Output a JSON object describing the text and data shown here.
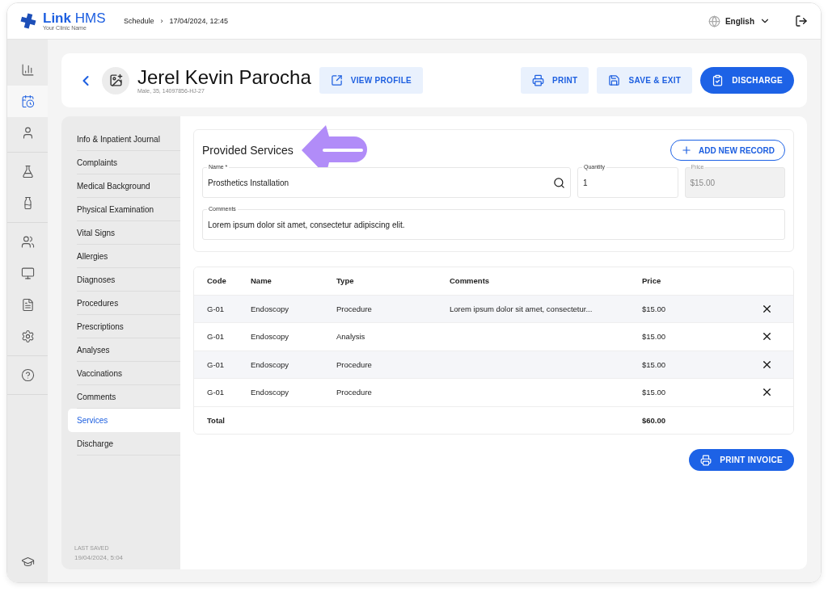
{
  "brand": {
    "name_bold": "Link",
    "name_light": "HMS",
    "subtitle": "Your Clinic Name"
  },
  "breadcrumb": {
    "items": [
      "Schedule",
      "17/04/2024, 12:45"
    ],
    "separator": "›"
  },
  "language": "English",
  "rail": [
    {
      "selected": false
    },
    {
      "selected": true
    },
    {
      "selected": false
    },
    {
      "selected": false
    },
    {
      "selected": false
    },
    {
      "selected": false
    },
    {
      "selected": false
    },
    {
      "selected": false
    },
    {
      "selected": false
    },
    {
      "selected": false
    },
    {
      "selected": false
    }
  ],
  "patient": {
    "name": "Jerel Kevin Parocha",
    "details": "Male, 35, 14097856-HJ-27"
  },
  "header_buttons": [
    {
      "label": "VIEW PROFILE",
      "kind": "soft"
    },
    {
      "label": "PRINT",
      "kind": "soft"
    },
    {
      "label": "SAVE & EXIT",
      "kind": "soft"
    },
    {
      "label": "DISCHARGE",
      "kind": "primary"
    }
  ],
  "sections": [
    {
      "label": "Info & Inpatient Journal",
      "selected": false
    },
    {
      "label": "Complaints",
      "selected": false
    },
    {
      "label": "Medical Background",
      "selected": false
    },
    {
      "label": "Physical Examination",
      "selected": false
    },
    {
      "label": "Vital Signs",
      "selected": false
    },
    {
      "label": "Allergies",
      "selected": false
    },
    {
      "label": "Diagnoses",
      "selected": false
    },
    {
      "label": "Procedures",
      "selected": false
    },
    {
      "label": "Prescriptions",
      "selected": false
    },
    {
      "label": "Analyses",
      "selected": false
    },
    {
      "label": "Vaccinations",
      "selected": false
    },
    {
      "label": "Comments",
      "selected": false
    },
    {
      "label": "Services",
      "selected": true
    },
    {
      "label": "Discharge",
      "selected": false
    }
  ],
  "last_saved": {
    "label": "LAST SAVED",
    "value": "19/04/2024, 5:04"
  },
  "form": {
    "title": "Provided Services",
    "add_button": "ADD NEW RECORD",
    "fields": [
      {
        "label": "Name *",
        "value": "Prosthetics Installation",
        "disabled": false
      },
      {
        "label": "Quantity",
        "value": "1",
        "disabled": false
      },
      {
        "label": "Price",
        "value": "$15.00",
        "disabled": true
      }
    ],
    "comments": {
      "label": "Comments",
      "value": "Lorem ipsum dolor sit amet, consectetur adipiscing elit."
    }
  },
  "table": {
    "columns": [
      "Code",
      "Name",
      "Type",
      "Comments",
      "Price"
    ],
    "rows": [
      {
        "cells": [
          "G-01",
          "Endoscopy",
          "Procedure",
          "Lorem ipsum dolor sit amet, consectetur...",
          "$15.00"
        ]
      },
      {
        "cells": [
          "G-01",
          "Endoscopy",
          "Analysis",
          "",
          "$15.00"
        ]
      },
      {
        "cells": [
          "G-01",
          "Endoscopy",
          "Procedure",
          "",
          "$15.00"
        ]
      },
      {
        "cells": [
          "G-01",
          "Endoscopy",
          "Procedure",
          "",
          "$15.00"
        ]
      }
    ],
    "total": {
      "label": "Total",
      "value": "$60.00"
    }
  },
  "print_invoice": "PRINT INVOICE"
}
